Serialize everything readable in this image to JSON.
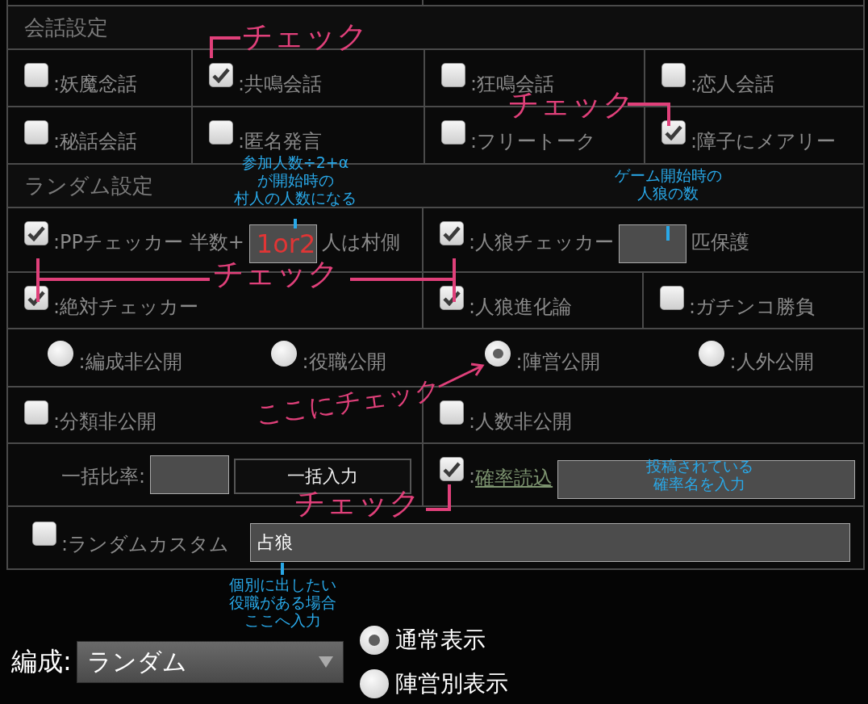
{
  "sections": [
    {
      "title": "会話設定",
      "rows": [
        {
          "kind": "quad",
          "cells": [
            {
              "kind": "checkbox",
              "label": ":妖魔念話",
              "checked": false
            },
            {
              "kind": "checkbox",
              "label": ":共鳴会話",
              "checked": true
            },
            {
              "kind": "checkbox",
              "label": ":狂鳴会話",
              "checked": false
            },
            {
              "kind": "checkbox",
              "label": ":恋人会話",
              "checked": false
            }
          ]
        },
        {
          "kind": "quad",
          "cells": [
            {
              "kind": "checkbox",
              "label": ":秘話会話",
              "checked": false
            },
            {
              "kind": "checkbox",
              "label": ":匿名発言",
              "checked": false
            },
            {
              "kind": "checkbox",
              "label": ":フリートーク",
              "checked": false
            },
            {
              "kind": "checkbox",
              "label": ":障子にメアリー",
              "checked": true
            }
          ]
        }
      ]
    },
    {
      "title": "ランダム設定",
      "rows": [
        {
          "kind": "half",
          "cells": [
            {
              "kind": "checkbox_input",
              "label": ":PPチェッカー 半数+",
              "checked": true,
              "value": "1or2",
              "suffix": "人は村側"
            },
            {
              "kind": "checkbox_input",
              "label": ":人狼チェッカー",
              "checked": true,
              "suffix": "匹保護"
            }
          ]
        },
        {
          "kind": "wide_left",
          "cells": [
            {
              "kind": "checkbox",
              "label": ":絶対チェッカー",
              "checked": true
            },
            {
              "kind": "checkbox",
              "label": ":人狼進化論",
              "checked": true
            },
            {
              "kind": "checkbox",
              "label": ":ガチンコ勝負",
              "checked": false
            }
          ]
        },
        {
          "kind": "radios",
          "options": [
            {
              "label": ":編成非公開",
              "selected": false
            },
            {
              "label": ":役職公開",
              "selected": false
            },
            {
              "label": ":陣営公開",
              "selected": true
            },
            {
              "label": ":人外公開",
              "selected": false
            }
          ]
        },
        {
          "kind": "half",
          "cells": [
            {
              "kind": "checkbox",
              "label": ":分類非公開",
              "checked": false
            },
            {
              "kind": "checkbox",
              "label": ":人数非公開",
              "checked": false
            }
          ]
        },
        {
          "kind": "half",
          "cells": [
            {
              "kind": "ratio",
              "label": "一括比率:",
              "button": "一括入力"
            },
            {
              "kind": "checkbox_link",
              "prefix": ":",
              "link": "確率読込",
              "checked": true
            }
          ]
        },
        {
          "kind": "full",
          "cells": [
            {
              "kind": "checkbox_text",
              "label": ":ランダムカスタム",
              "checked": false,
              "value": "占狼"
            }
          ]
        }
      ]
    }
  ],
  "composition": {
    "label": "編成:",
    "value": "ランダム"
  },
  "display_options": [
    {
      "label": "通常表示",
      "selected": true
    },
    {
      "label": "陣営別表示",
      "selected": false
    }
  ],
  "annotations": [
    {
      "kind": "pink",
      "lines": [
        "チェック"
      ]
    },
    {
      "kind": "pink",
      "lines": [
        "チェック"
      ]
    },
    {
      "kind": "blue",
      "lines": [
        "参加人数÷2+α",
        "が開始時の",
        "村人の人数になる"
      ]
    },
    {
      "kind": "blue",
      "lines": [
        "ゲーム開始時の",
        "人狼の数"
      ]
    },
    {
      "kind": "pink",
      "lines": [
        "チェック"
      ]
    },
    {
      "kind": "pink",
      "lines": [
        "ここにチェック"
      ]
    },
    {
      "kind": "blue",
      "lines": [
        "投稿されている",
        "確率名を入力"
      ]
    },
    {
      "kind": "pink",
      "lines": [
        "チェック"
      ]
    },
    {
      "kind": "blue",
      "lines": [
        "個別に出したい",
        "役職がある場合",
        "ここへ入力"
      ]
    }
  ]
}
